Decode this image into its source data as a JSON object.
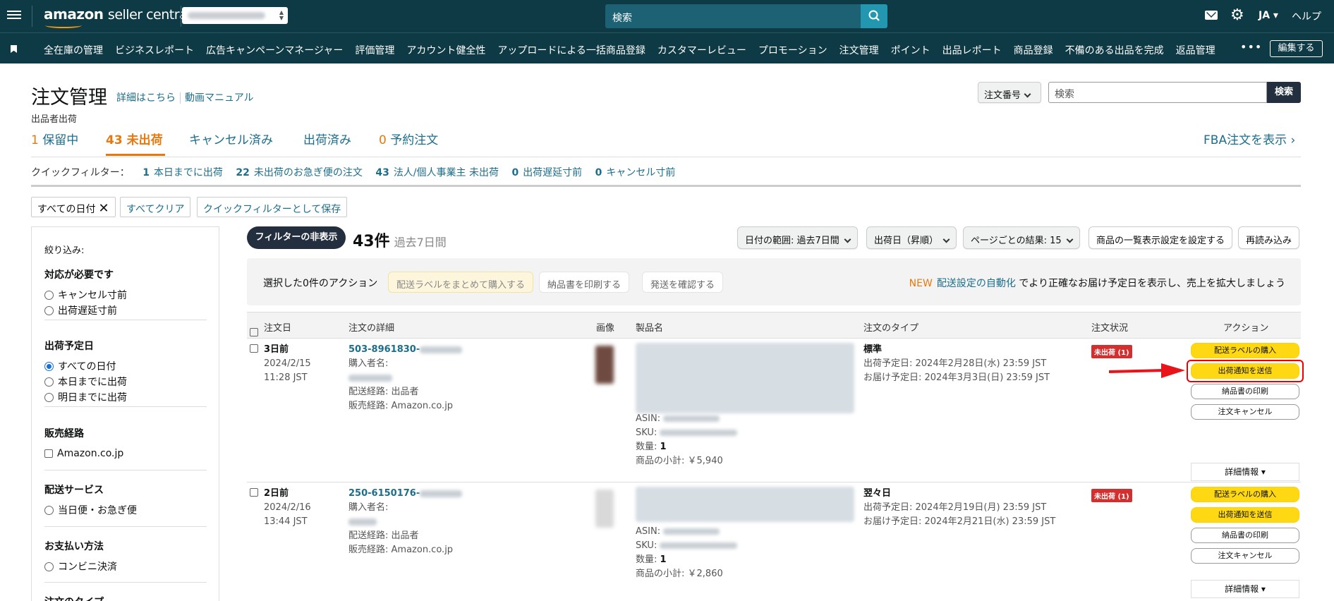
{
  "topbar": {
    "logo_main": "amazon",
    "logo_sub": "seller central",
    "search_placeholder": "検索",
    "lang": "JA ▾",
    "help": "ヘルプ"
  },
  "nav": {
    "items": [
      "全在庫の管理",
      "ビジネスレポート",
      "広告キャンペーンマネージャー",
      "評価管理",
      "アカウント健全性",
      "アップロードによる一括商品登録",
      "カスタマーレビュー",
      "プロモーション",
      "注文管理",
      "ポイント",
      "出品レポート",
      "商品登録",
      "不備のある出品を完成",
      "返品管理"
    ],
    "more": "•••",
    "edit": "編集する"
  },
  "header": {
    "title": "注文管理",
    "link_details": "詳細はこちら",
    "link_video": "動画マニュアル",
    "subtitle": "出品者出荷",
    "search_select": "注文番号",
    "search_placeholder": "検索",
    "search_button": "検索"
  },
  "tabs": {
    "pending_num": "1",
    "pending_label": "保留中",
    "unshipped_num": "43",
    "unshipped_label": "未出荷",
    "cancelled_label": "キャンセル済み",
    "shipped_label": "出荷済み",
    "preorder_num": "0",
    "preorder_label": "予約注文",
    "fba": "FBA注文を表示 ›"
  },
  "quickfilter": {
    "label": "クイックフィルター：",
    "items": [
      {
        "num": "1",
        "label": "本日までに出荷"
      },
      {
        "num": "22",
        "label": "未出荷のお急ぎ便の注文"
      },
      {
        "num": "43",
        "label": "法人/個人事業主 未出荷"
      },
      {
        "num": "0",
        "label": "出荷遅延寸前"
      },
      {
        "num": "0",
        "label": "キャンセル寸前"
      }
    ]
  },
  "chips": {
    "all_dates": "すべての日付",
    "clear_all": "すべてクリア",
    "save_filter": "クイックフィルターとして保存"
  },
  "sidebar": {
    "title": "絞り込み:",
    "s1_title": "対応が必要です",
    "s1_opt1": "キャンセル寸前",
    "s1_opt2": "出荷遅延寸前",
    "s2_title": "出荷予定日",
    "s2_opt1": "すべての日付",
    "s2_opt2": "本日までに出荷",
    "s2_opt3": "明日までに出荷",
    "s3_title": "販売経路",
    "s3_opt1": "Amazon.co.jp",
    "s4_title": "配送サービス",
    "s4_opt1": "当日便・お急ぎ便",
    "s5_title": "お支払い方法",
    "s5_opt1": "コンビニ決済",
    "s6_title": "注文のタイプ"
  },
  "results": {
    "filter_toggle": "フィルターの非表示",
    "count": "43件",
    "period": "過去7日間",
    "date_range": "日付の範囲: 過去7日間",
    "sort": "出荷日（昇順）",
    "per_page": "ページごとの結果: 15",
    "list_settings": "商品の一覧表示設定を設定する",
    "reload": "再読み込み"
  },
  "actionbar": {
    "label": "選択した0件のアクション",
    "buy_labels": "配送ラベルをまとめて購入する",
    "print_slip": "納品書を印刷する",
    "confirm_ship": "発送を確認する",
    "new": "NEW",
    "link": "配送設定の自動化",
    "note": "でより正確なお届け予定日を表示し、売上を拡大しましょう"
  },
  "table": {
    "headers": [
      "注文日",
      "注文の詳細",
      "画像",
      "製品名",
      "注文のタイプ",
      "注文状況",
      "アクション"
    ],
    "rows": [
      {
        "age": "3日前",
        "date": "2024/2/15",
        "time": "11:28 JST",
        "order_id": "503-8961830-",
        "buyer_label": "購入者名:",
        "channel": "配送経路: 出品者",
        "sales": "販売経路: Amazon.co.jp",
        "asin_label": "ASIN:",
        "sku_label": "SKU:",
        "qty_label": "数量:",
        "qty": "1",
        "subtotal_label": "商品の小計:",
        "subtotal": "￥5,940",
        "type": "標準",
        "ship_by": "出荷予定日: 2024年2月28日(水) 23:59 JST",
        "deliver_by": "お届け予定日: 2024年3月3日(日) 23:59 JST",
        "status": "未出荷 (1)",
        "btn_buy": "配送ラベルの購入",
        "btn_notify": "出荷通知を送信",
        "btn_print": "納品書の印刷",
        "btn_cancel": "注文キャンセル",
        "details": "詳細情報 ▾"
      },
      {
        "age": "2日前",
        "date": "2024/2/16",
        "time": "13:44 JST",
        "order_id": "250-6150176-",
        "buyer_label": "購入者名:",
        "channel": "配送経路: 出品者",
        "sales": "販売経路: Amazon.co.jp",
        "asin_label": "ASIN:",
        "sku_label": "SKU:",
        "qty_label": "数量:",
        "qty": "1",
        "subtotal_label": "商品の小計:",
        "subtotal": "￥2,860",
        "type": "翌々日",
        "ship_by": "出荷予定日: 2024年2月19日(月) 23:59 JST",
        "deliver_by": "お届け予定日: 2024年2月21日(水) 23:59 JST",
        "status": "未出荷 (1)",
        "btn_buy": "配送ラベルの購入",
        "btn_notify": "出荷通知を送信",
        "btn_print": "納品書の印刷",
        "btn_cancel": "注文キャンセル",
        "details": "詳細情報 ▾"
      }
    ]
  },
  "colors": {
    "topbar": "#0e3a45",
    "accent_orange": "#e47911",
    "link": "#1c6e8c",
    "button_yellow": "#ffd814",
    "highlight_red": "#e00000"
  }
}
